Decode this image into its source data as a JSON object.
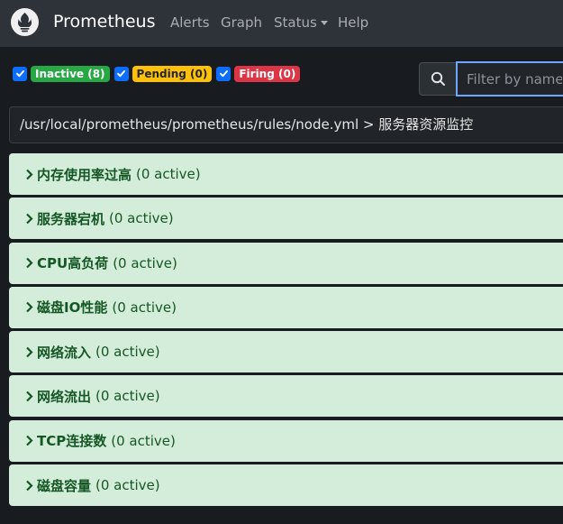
{
  "nav": {
    "brand": "Prometheus",
    "links": [
      "Alerts",
      "Graph",
      "Status",
      "Help"
    ]
  },
  "filters": {
    "inactive": "Inactive (8)",
    "pending": "Pending (0)",
    "firing": "Firing (0)"
  },
  "search": {
    "placeholder": "Filter by name or labels"
  },
  "file_header": "/usr/local/prometheus/prometheus/rules/node.yml > 服务器资源监控",
  "rules": [
    {
      "name": "内存使用率过高",
      "state": "(0 active)"
    },
    {
      "name": "服务器宕机",
      "state": "(0 active)"
    },
    {
      "name": "CPU高负荷",
      "state": "(0 active)"
    },
    {
      "name": "磁盘IO性能",
      "state": "(0 active)"
    },
    {
      "name": "网络流入",
      "state": "(0 active)"
    },
    {
      "name": "网络流出",
      "state": "(0 active)"
    },
    {
      "name": "TCP连接数",
      "state": "(0 active)"
    },
    {
      "name": "磁盘容量",
      "state": "(0 active)"
    }
  ],
  "colors": {
    "navbar": "#2e3339",
    "background": "#181b1f",
    "inactive": "#28a745",
    "pending": "#ffc107",
    "firing": "#dc3545",
    "rule_bg": "#d4edda",
    "rule_text": "#155724"
  },
  "icons": [
    "prometheus-logo-icon",
    "check-icon",
    "search-icon",
    "chevron-right-icon",
    "caret-down-icon"
  ]
}
